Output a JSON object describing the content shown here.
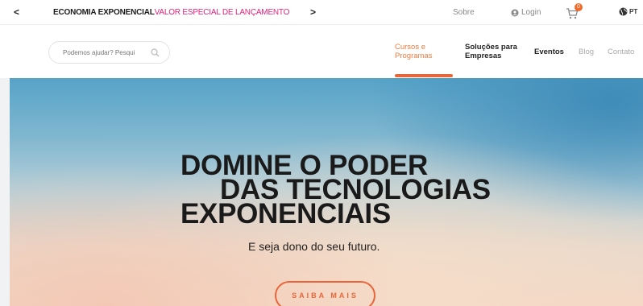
{
  "topbar": {
    "promo_bold": "ECONOMIA EXPONENCIAL",
    "promo_highlight": "VALOR ESPECIAL DE LANÇAMENTO",
    "sobre": "Sobre",
    "login": "Login",
    "cart_count": "0",
    "lang": "PT",
    "highlight_color": "#e0237a"
  },
  "search": {
    "placeholder": "Podemos ajudar? Pesqui"
  },
  "nav": {
    "cursos_line1": "Cursos e",
    "cursos_line2": "Programas",
    "solucoes_line1": "Soluções para",
    "solucoes_line2": "Empresas",
    "eventos": "Eventos",
    "blog": "Blog",
    "contato": "Contato",
    "accent_color": "#e8673a"
  },
  "hero": {
    "title_line1": "DOMINE O PODER",
    "title_line2": "DAS TECNOLOGIAS",
    "title_line3": "EXPONENCIAIS",
    "subtitle": "E seja dono do seu futuro.",
    "cta": "SAIBA MAIS"
  }
}
